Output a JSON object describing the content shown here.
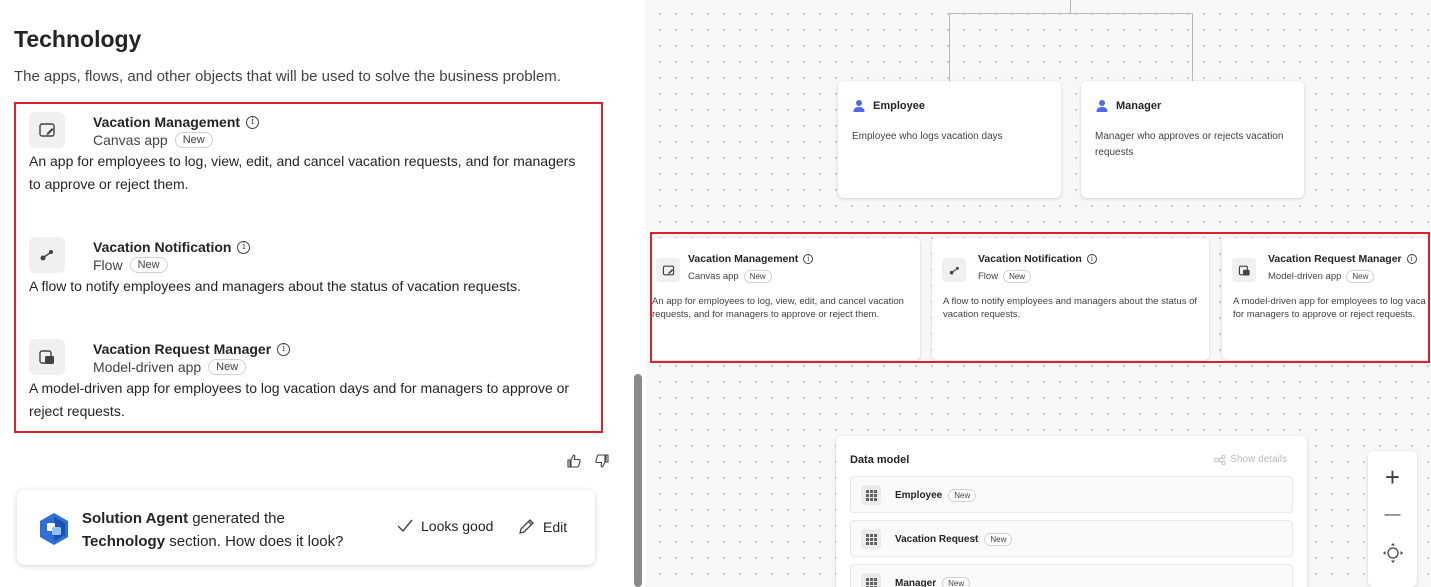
{
  "left_panel": {
    "section_title": "Technology",
    "section_description": "The apps, flows, and other objects that will be used to solve the business problem.",
    "items": [
      {
        "name": "Vacation Management",
        "type": "Canvas app",
        "badge": "New",
        "icon": "canvas-app-icon",
        "description": "An app for employees to log, view, edit, and cancel vacation requests, and for managers to approve or reject them."
      },
      {
        "name": "Vacation Notification",
        "type": "Flow",
        "badge": "New",
        "icon": "flow-icon",
        "description": "A flow to notify employees and managers about the status of vacation requests."
      },
      {
        "name": "Vacation Request Manager",
        "type": "Model-driven app",
        "badge": "New",
        "icon": "model-driven-app-icon",
        "description": "A model-driven app for employees to log vacation days and for managers to approve or reject requests."
      }
    ],
    "feedback": {
      "like_icon": "thumbs-up-icon",
      "dislike_icon": "thumbs-down-icon"
    },
    "agent_card": {
      "agent_name": "Solution Agent",
      "text_mid": " generated the ",
      "section_name": "Technology",
      "text_end": " section. How does it look?",
      "looks_good_label": "Looks good",
      "edit_label": "Edit"
    }
  },
  "canvas": {
    "personas": [
      {
        "name": "Employee",
        "description": "Employee who logs vacation days",
        "icon": "person-icon"
      },
      {
        "name": "Manager",
        "description": "Manager who approves or rejects vacation requests",
        "icon": "person-icon"
      }
    ],
    "tech_cards": [
      {
        "name": "Vacation Management",
        "type": "Canvas app",
        "badge": "New",
        "description": "An app for employees to log, view, edit, and cancel vacation requests, and for managers to approve or reject them."
      },
      {
        "name": "Vacation Notification",
        "type": "Flow",
        "badge": "New",
        "description": "A flow to notify employees and managers about the status of vacation requests."
      },
      {
        "name": "Vacation Request Manager",
        "type": "Model-driven app",
        "badge": "New",
        "description": "A model-driven app for employees to log vaca for managers to approve or reject requests."
      }
    ],
    "data_model": {
      "title": "Data model",
      "show_details_label": "Show details",
      "tables": [
        {
          "name": "Employee",
          "badge": "New"
        },
        {
          "name": "Vacation Request",
          "badge": "New"
        },
        {
          "name": "Manager",
          "badge": "New"
        }
      ]
    },
    "zoom_controls": {
      "zoom_in": "+",
      "zoom_out": "—",
      "fit": "fit-view-icon"
    },
    "colors": {
      "highlight": "#d9222a",
      "persona_icon": "#4f6bed"
    }
  }
}
